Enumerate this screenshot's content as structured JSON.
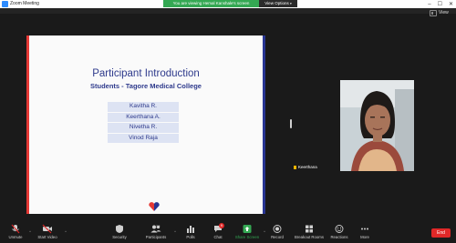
{
  "window": {
    "title": "Zoom Meeting"
  },
  "banner": {
    "text": "You are viewing Hemal Kanshale's screen",
    "view_options": "View Options"
  },
  "top_right": {
    "label": "View"
  },
  "slide": {
    "title": "Participant Introduction",
    "subtitle": "Students - Tagore Medical College",
    "names": [
      "Kavitha R.",
      "Keerthana A.",
      "Nivetha R.",
      "Vinod Raja"
    ]
  },
  "participant": {
    "name": "Keerthana"
  },
  "toolbar": {
    "unmute": "Unmute",
    "start_video": "Start Video",
    "security": "Security",
    "participants": "Participants",
    "participants_count": "22",
    "polls": "Polls",
    "chat": "Chat",
    "chat_badge": "9",
    "share_screen": "Share Screen",
    "record": "Record",
    "breakout_rooms": "Breakout Rooms",
    "reactions": "Reactions",
    "more": "More",
    "end": "End"
  },
  "colors": {
    "accent": "#2d8cff",
    "banner_green": "#34a853",
    "end_red": "#e02828",
    "slide_title_blue": "#2e3a8c"
  }
}
